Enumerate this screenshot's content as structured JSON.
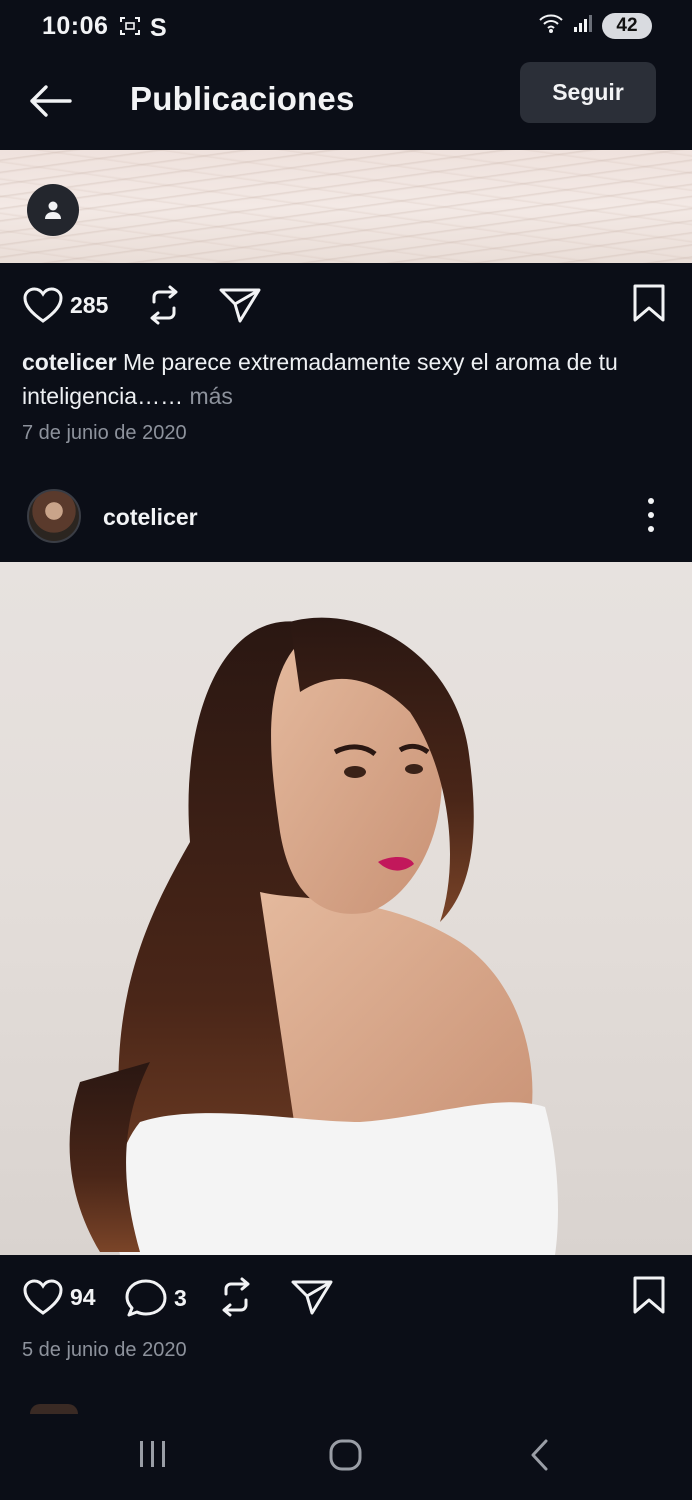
{
  "status_bar": {
    "time": "10:06",
    "battery": "42"
  },
  "header": {
    "title": "Publicaciones",
    "follow_label": "Seguir"
  },
  "post1": {
    "likes": "285",
    "caption_user": "cotelicer",
    "caption_text": "Me parece extremadamente sexy el aroma  de tu inteligencia……",
    "more_label": "más",
    "date": "7 de junio de 2020"
  },
  "post2": {
    "author": "cotelicer",
    "likes": "94",
    "comments": "3",
    "date": "5 de junio de 2020"
  },
  "icons": {
    "status": [
      "screenshot-icon",
      "s-app-icon",
      "wifi-icon",
      "signal-icon",
      "battery-icon"
    ],
    "actions": [
      "heart-icon",
      "comment-icon",
      "repost-icon",
      "send-icon",
      "bookmark-icon"
    ],
    "nav": [
      "recents-icon",
      "home-icon",
      "back-nav-icon"
    ]
  },
  "colors": {
    "background": "#0b0e17",
    "follow_button": "#2b2f38",
    "muted_text": "#8d929c"
  }
}
